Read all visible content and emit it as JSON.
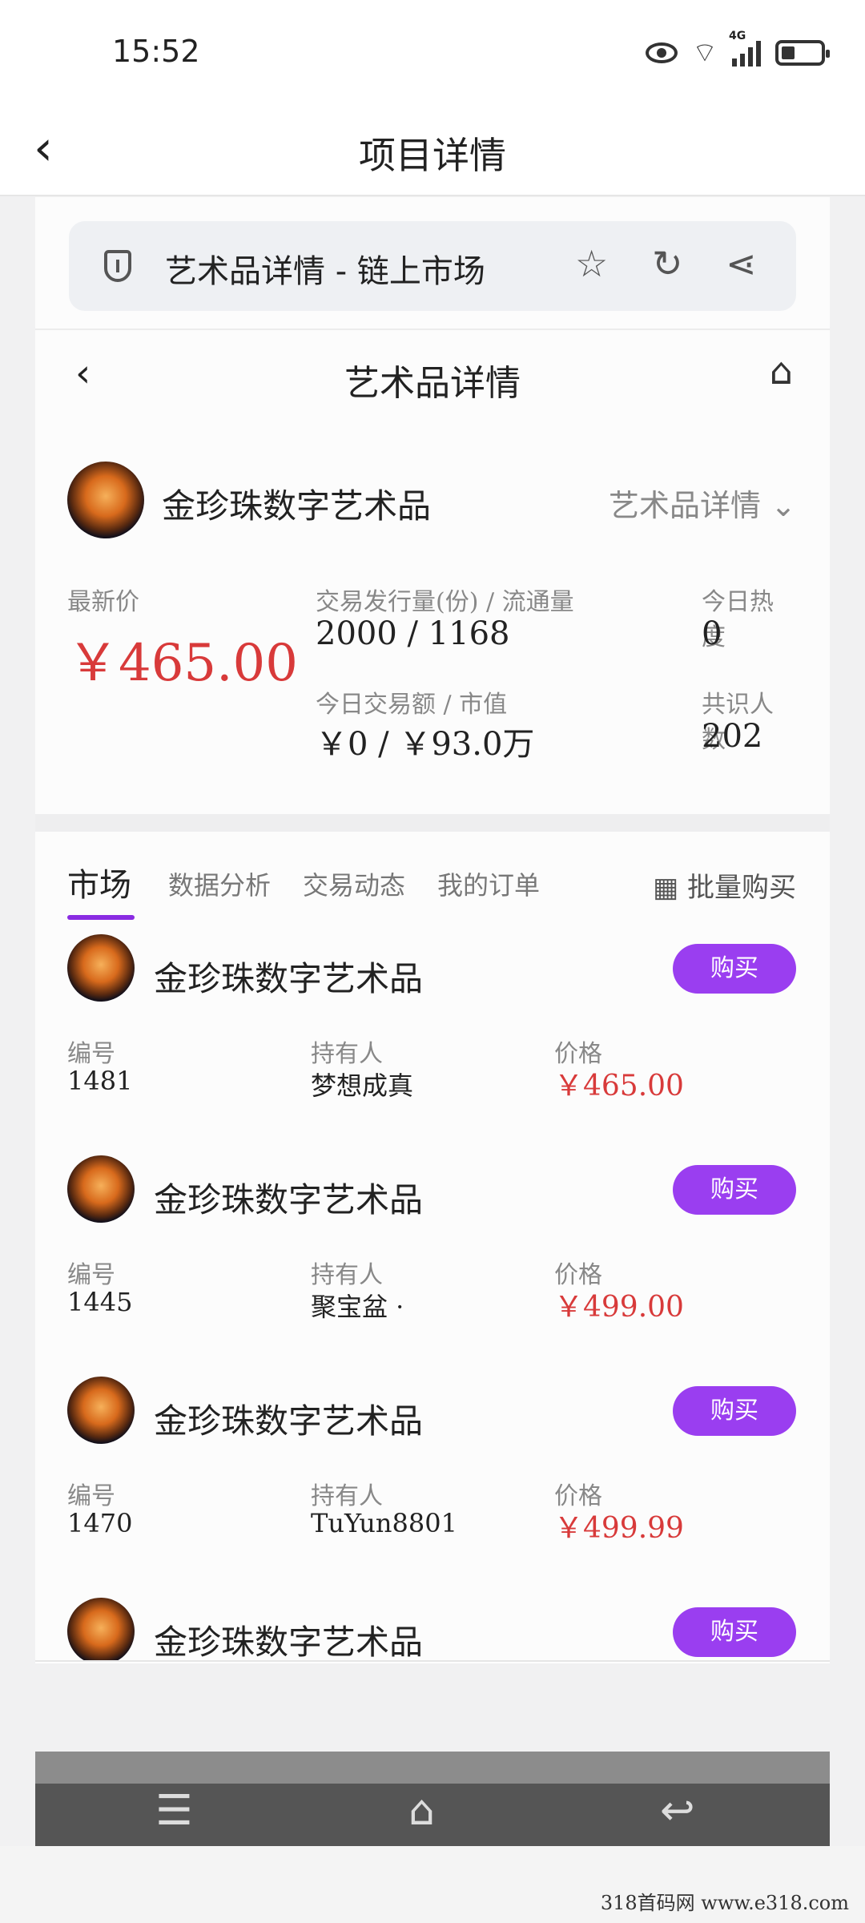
{
  "status": {
    "time": "15:52",
    "network": "4G"
  },
  "app": {
    "back": "‹",
    "title": "项目详情"
  },
  "browser": {
    "url_title": "艺术品详情 - 链上市场",
    "icons": [
      "shield-icon",
      "star-check-icon",
      "refresh-icon",
      "share-icon"
    ]
  },
  "page": {
    "back": "‹",
    "title": "艺术品详情"
  },
  "item": {
    "name": "金珍珠数字艺术品",
    "dropdown": "艺术品详情",
    "latest_label": "最新价",
    "latest_price": "￥465.00",
    "issue_label": "交易发行量(份) / 流通量",
    "issue_value": "2000 / 1168",
    "heat_label": "今日热度",
    "heat_value": "0",
    "turnover_label": "今日交易额 / 市值",
    "turnover_value": "￥0 / ￥93.0万",
    "holders_label": "共识人数",
    "holders_value": "202"
  },
  "tabs": {
    "market": "市场",
    "analysis": "数据分析",
    "trades": "交易动态",
    "orders": "我的订单",
    "bulk": "批量购买"
  },
  "listings": [
    {
      "name": "金珍珠数字艺术品",
      "buy": "购买",
      "id_label": "编号",
      "id": "1481",
      "owner_label": "持有人",
      "owner": "梦想成真",
      "price_label": "价格",
      "price": "￥465.00"
    },
    {
      "name": "金珍珠数字艺术品",
      "buy": "购买",
      "id_label": "编号",
      "id": "1445",
      "owner_label": "持有人",
      "owner": "聚宝盆 ·",
      "price_label": "价格",
      "price": "￥499.00"
    },
    {
      "name": "金珍珠数字艺术品",
      "buy": "购买",
      "id_label": "编号",
      "id": "1470",
      "owner_label": "持有人",
      "owner": "TuYun8801",
      "price_label": "价格",
      "price": "￥499.99"
    },
    {
      "name": "金珍珠数字艺术品",
      "buy": "购买"
    }
  ],
  "watermark": "318首码网  www.e318.com",
  "colors": {
    "accent": "#9a3ef0",
    "price": "#d83a3a"
  }
}
